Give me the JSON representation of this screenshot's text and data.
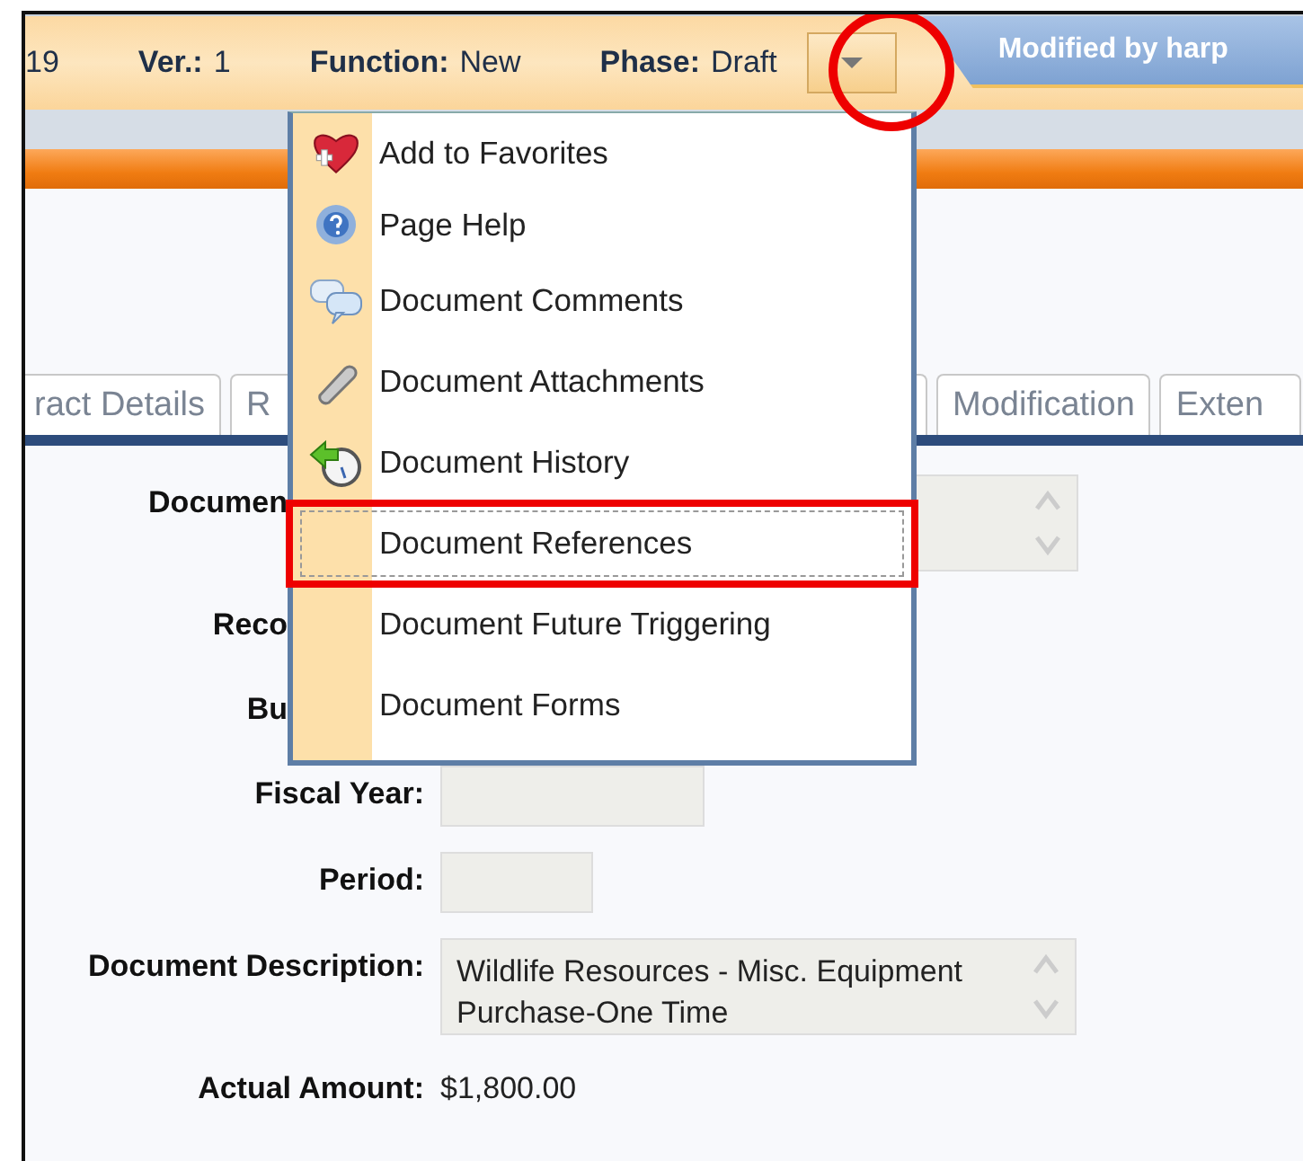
{
  "header": {
    "fields": [
      {
        "value": "19"
      },
      {
        "label": "Ver.:",
        "value": "1"
      },
      {
        "label": "Function:",
        "value": "New"
      },
      {
        "label": "Phase:",
        "value": "Draft"
      }
    ],
    "modified": "Modified by harp"
  },
  "menu": {
    "items": [
      {
        "label": "Add to Favorites",
        "selected": false
      },
      {
        "label": "Page Help",
        "selected": false
      },
      {
        "label": "Document Comments",
        "selected": false
      },
      {
        "label": "Document Attachments",
        "selected": false
      },
      {
        "label": "Document History",
        "selected": false
      },
      {
        "label": "Document References",
        "selected": true
      },
      {
        "label": "Document Future Triggering",
        "selected": false
      },
      {
        "label": "Document Forms",
        "selected": false
      }
    ]
  },
  "tabs": [
    {
      "label": "ract Details"
    },
    {
      "label": "R"
    },
    {
      "label": "Modification"
    },
    {
      "label": "Exten"
    }
  ],
  "form": [
    {
      "label": "Documen",
      "kind": "coveredarea"
    },
    {
      "label": "Reco",
      "kind": "covered"
    },
    {
      "label": "Bu",
      "kind": "covered"
    },
    {
      "label": "Fiscal Year:",
      "kind": "wideinput"
    },
    {
      "label": "Period:",
      "kind": "shortinput"
    },
    {
      "label": "Document Description:",
      "kind": "textarea",
      "value": "Wildlife Resources - Misc. Equipment Purchase-One Time"
    },
    {
      "label": "Actual Amount:",
      "kind": "text",
      "value": "$1,800.00"
    }
  ]
}
